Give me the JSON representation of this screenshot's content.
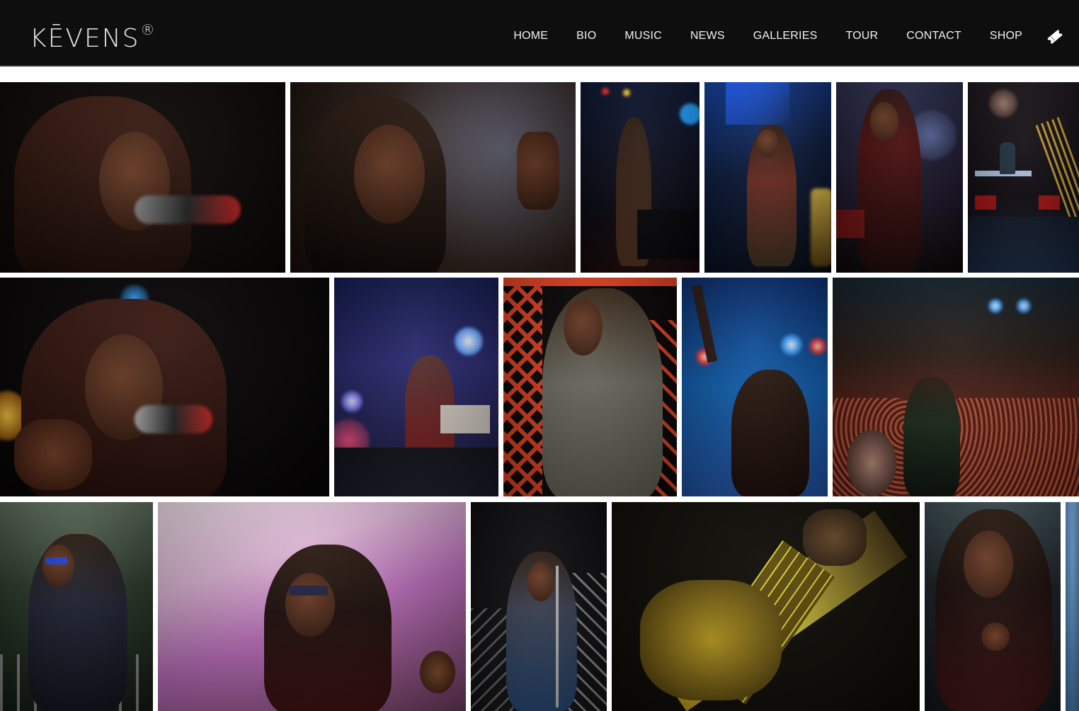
{
  "brand": {
    "logo_text": "KĒVENS",
    "registered_mark": "®"
  },
  "nav": {
    "items": [
      {
        "label": "HOME"
      },
      {
        "label": "BIO"
      },
      {
        "label": "MUSIC"
      },
      {
        "label": "NEWS"
      },
      {
        "label": "GALLERIES"
      },
      {
        "label": "TOUR"
      },
      {
        "label": "CONTACT"
      },
      {
        "label": "SHOP"
      }
    ],
    "ticket_icon": "ticket-icon"
  },
  "gallery": {
    "photos": [
      {
        "subject": "close-up singing, dark background",
        "bg": "#0a0605"
      },
      {
        "subject": "close-up singing with raised finger",
        "bg": "#1c1410"
      },
      {
        "subject": "singer on stage, blue and red lights",
        "bg": "#0c1430"
      },
      {
        "subject": "singer on stage, blue spotlight",
        "bg": "#0d1a3c"
      },
      {
        "subject": "singer in red jacket on stage",
        "bg": "#1a1a2a"
      },
      {
        "subject": "keyboard player on stage",
        "bg": "#14101a"
      },
      {
        "subject": "close-up singing, black background",
        "bg": "#050303"
      },
      {
        "subject": "performer on festival stage",
        "bg": "#1a1848"
      },
      {
        "subject": "singer by red truss",
        "bg": "#3a0c08"
      },
      {
        "subject": "singer with raised arm, blue lights",
        "bg": "#0a3a7a"
      },
      {
        "subject": "singer pointing at crowd",
        "bg": "#2a1612"
      },
      {
        "subject": "singer on outdoor stage",
        "bg": "#3a4038"
      },
      {
        "subject": "singer smiling under tent",
        "bg": "#c8a8c8"
      },
      {
        "subject": "singer with microphone stand",
        "bg": "#121214"
      },
      {
        "subject": "guitar close-up",
        "bg": "#0c0a04"
      },
      {
        "subject": "singer portrait",
        "bg": "#202a30"
      },
      {
        "subject": "partial photo",
        "bg": "#4a78a8"
      }
    ]
  }
}
